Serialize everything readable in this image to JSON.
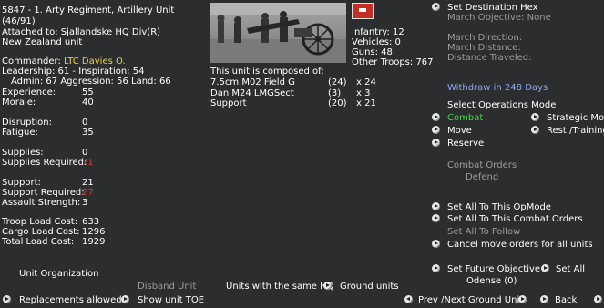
{
  "header": {
    "unit_title": "5847 - 1. Arty Regiment, Artillery Unit",
    "unit_count": "(46/91)",
    "attached": "Attached to: Sjallandske HQ Div(R)",
    "nationality": "New Zealand unit"
  },
  "commander": {
    "label": "Commander:",
    "name": "LTC Davies O."
  },
  "ratings": {
    "leadership_line": "Leadership: 61 - Inspiration: 54",
    "admin_line": "Admin: 67  Aggression: 56 Land: 66"
  },
  "stats": [
    {
      "label": "Experience:",
      "value": "55"
    },
    {
      "label": "Morale:",
      "value": "40"
    },
    {
      "label": "Disruption:",
      "value": "0"
    },
    {
      "label": "Fatigue:",
      "value": "35"
    },
    {
      "label": "Supplies:",
      "value": "0"
    },
    {
      "label": "Supplies Required:",
      "value": "71"
    },
    {
      "label": "Support:",
      "value": "21"
    },
    {
      "label": "Support Required:",
      "value": "27"
    },
    {
      "label": "Assault Strength:",
      "value": "3"
    },
    {
      "label": "Troop Load Cost:",
      "value": "633"
    },
    {
      "label": "Cargo Load Cost:",
      "value": "1296"
    },
    {
      "label": "Total Load Cost:",
      "value": "1929"
    }
  ],
  "troops": {
    "infantry": "Infantry: 12",
    "vehicles": "Vehicles: 0",
    "guns": "Guns: 48",
    "other": "Other Troops: 767"
  },
  "composition": {
    "heading": "This unit is composed of:",
    "rows": [
      {
        "name": "7.5cm M02 Field G",
        "count": "(24)",
        "mult": "x 24"
      },
      {
        "name": "Dan M24 LMGSect",
        "count": "(3)",
        "mult": "x  3"
      },
      {
        "name": "Support",
        "count": "(20)",
        "mult": "x 21"
      }
    ]
  },
  "destination": {
    "set_label": "Set Destination Hex",
    "march_objective": "March Objective: None",
    "march_direction": "March Direction:",
    "march_distance": "March Distance:",
    "distance_traveled": "Distance Traveled:"
  },
  "withdraw": "Withdraw in 248 Days",
  "operations": {
    "heading": "Select Operations Mode",
    "combat": "Combat",
    "move": "Move",
    "reserve": "Reserve",
    "strategic": "Strategic Mov",
    "rest": "Rest /Training"
  },
  "combat_orders": {
    "heading": "Combat Orders",
    "value": "Defend"
  },
  "actions": {
    "set_all_opmode": "Set All To This OpMode",
    "set_all_combat": "Set All To This Combat Orders",
    "set_all_follow": "Set All To Follow",
    "cancel_move": "Cancel move orders for all units",
    "set_future": "Set Future Objective",
    "set_all": "Set All",
    "odense": "Odense (0)"
  },
  "bottom": {
    "unit_organization": "Unit Organization",
    "disband": "Disband Unit",
    "same_hq": "Units with the same HQ",
    "ground_units": "Ground units",
    "replacements": "Replacements allowed",
    "show_toe": "Show unit TOE",
    "prev_next": "Prev /Next Ground Unit",
    "back": "Back"
  },
  "icons": {
    "nav_arrow": "arrow-right-icon",
    "prev_arrow": "arrow-left-icon",
    "flag": "national-flag-icon",
    "photo": "artillery-photo"
  },
  "colors": {
    "background": "#2b2d2f",
    "commander": "#e6d23a",
    "warning": "#c43c3c",
    "active_mode": "#3fd53f",
    "withdraw": "#8fa8ec",
    "disabled": "#9c9c9c"
  }
}
